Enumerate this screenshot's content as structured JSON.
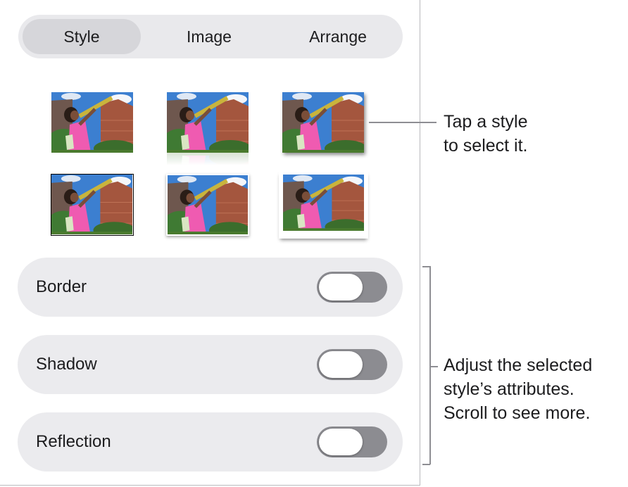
{
  "tabs": [
    {
      "label": "Style",
      "selected": true
    },
    {
      "label": "Image",
      "selected": false
    },
    {
      "label": "Arrange",
      "selected": false
    }
  ],
  "style_presets": [
    {
      "name": "plain"
    },
    {
      "name": "reflection"
    },
    {
      "name": "drop-shadow"
    },
    {
      "name": "black-border"
    },
    {
      "name": "white-border-shadow"
    },
    {
      "name": "curled-shadow"
    }
  ],
  "attributes": [
    {
      "label": "Border",
      "on": false
    },
    {
      "label": "Shadow",
      "on": false
    },
    {
      "label": "Reflection",
      "on": false
    }
  ],
  "callouts": {
    "styles_line1": "Tap a style",
    "styles_line2": "to select it.",
    "attrs_line1": "Adjust the selected",
    "attrs_line2": "style’s attributes.",
    "attrs_line3": "Scroll to see more."
  },
  "colors": {
    "panel_bg": "#ffffff",
    "control_bg": "#ebebee",
    "segment_selected": "#d6d6da",
    "toggle_off": "#8c8c91"
  }
}
